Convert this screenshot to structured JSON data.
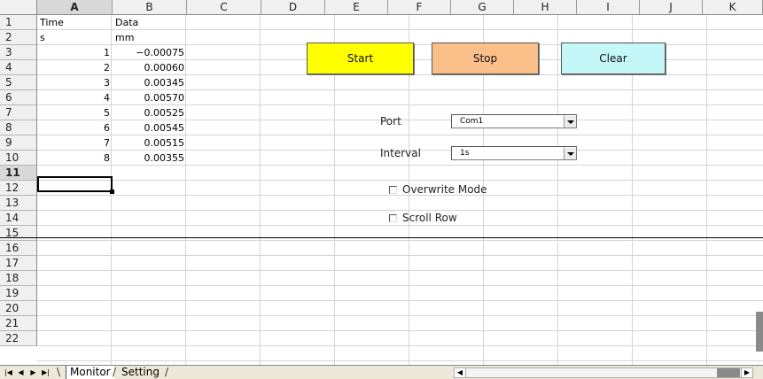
{
  "columns": [
    "A",
    "B",
    "C",
    "D",
    "E",
    "F",
    "G",
    "H",
    "I",
    "J",
    "K"
  ],
  "rows": [
    "1",
    "2",
    "3",
    "4",
    "5",
    "6",
    "7",
    "8",
    "9",
    "10",
    "11",
    "12",
    "13",
    "14",
    "15",
    "16",
    "17",
    "18",
    "19",
    "20",
    "21",
    "22"
  ],
  "active_column": "A",
  "active_row": "11",
  "cells": {
    "A1": "Time",
    "B1": "Data",
    "A2": "s",
    "B2": "mm",
    "A3": "1",
    "B3": "−0.00075",
    "A4": "2",
    "B4": "0.00060",
    "A5": "3",
    "B5": "0.00345",
    "A6": "4",
    "B6": "0.00570",
    "A7": "5",
    "B7": "0.00525",
    "A8": "6",
    "B8": "0.00545",
    "A9": "7",
    "B9": "0.00515",
    "A10": "8",
    "B10": "0.00355"
  },
  "controls": {
    "start_label": "Start",
    "stop_label": "Stop",
    "clear_label": "Clear",
    "port_label": "Port",
    "port_value": "Com1",
    "interval_label": "Interval",
    "interval_value": "1s",
    "overwrite_label": "Overwrite Mode",
    "overwrite_checked": false,
    "scroll_row_label": "Scroll Row",
    "scroll_row_checked": false
  },
  "colors": {
    "start": "#ffff00",
    "stop": "#fbbf8a",
    "clear": "#c4f7f7"
  },
  "sheet_tabs": {
    "active": "Monitor",
    "other": "Setting"
  },
  "icons": {
    "first": "first-sheet-icon",
    "prev": "prev-sheet-icon",
    "next": "next-sheet-icon",
    "last": "last-sheet-icon"
  }
}
